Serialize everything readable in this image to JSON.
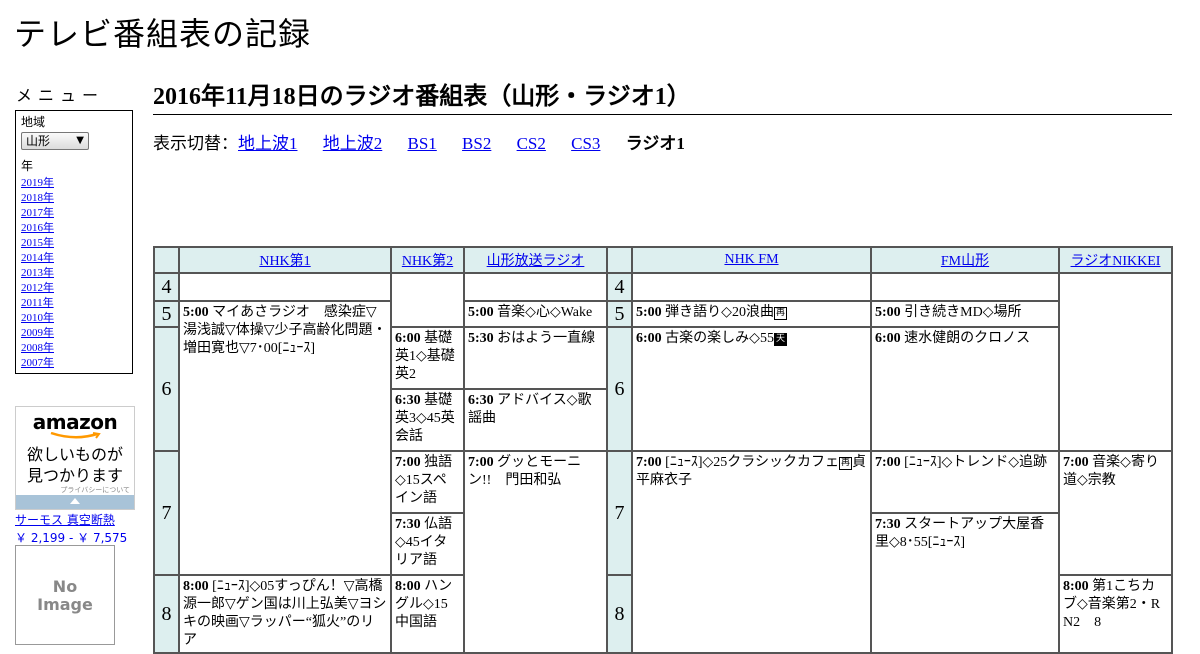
{
  "site_title": "テレビ番組表の記録",
  "menu": {
    "heading": "メニュー",
    "region_label": "地域",
    "region_value": "山形",
    "year_label": "年",
    "years": [
      "2019年",
      "2018年",
      "2017年",
      "2016年",
      "2015年",
      "2014年",
      "2013年",
      "2012年",
      "2011年",
      "2010年",
      "2009年",
      "2008年",
      "2007年"
    ]
  },
  "ads": {
    "amazon_logo": "amazon",
    "amazon_copy_1": "欲しいものが",
    "amazon_copy_2": "見つかります",
    "amazon_privacy": "プライバシーについて",
    "product_name": "サーモス 真空断熱",
    "product_price": "￥ 2,199 - ￥ 7,575",
    "noimage_1": "No",
    "noimage_2": "Image"
  },
  "page_title": "2016年11月18日のラジオ番組表（山形・ラジオ1）",
  "display_switch": {
    "label": "表示切替：",
    "options": [
      "地上波1",
      "地上波2",
      "BS1",
      "BS2",
      "CS2",
      "CS3"
    ],
    "current": "ラジオ1"
  },
  "schedule": {
    "channels": [
      "NHK第1",
      "NHK第2",
      "山形放送ラジオ",
      "NHK FM",
      "FM山形",
      "ラジオNIKKEI"
    ],
    "hours": [
      "4",
      "5",
      "6",
      "7",
      "8"
    ],
    "programs": {
      "nhk1_500_time": "5:00",
      "nhk1_500_title": "マイあさラジオ　感染症▽湯浅誠▽体操▽少子高齢化問題・増田寛也▽7･00[ﾆｭｰｽ]",
      "nhk1_800_time": "8:00",
      "nhk1_800_title": "[ﾆｭｰｽ]◇05すっぴん！▽高橋源一郎▽ゲン国は川上弘美▽ヨシキの映画▽ラッパー“狐火”のリア",
      "nhk2_600_time": "6:00",
      "nhk2_600_title": "基礎英1◇基礎英2",
      "nhk2_630_time": "6:30",
      "nhk2_630_title": "基礎英3◇45英会話",
      "nhk2_700_time": "7:00",
      "nhk2_700_title": "独語◇15スペイン語",
      "nhk2_730_time": "7:30",
      "nhk2_730_title": "仏語◇45イタリア語",
      "nhk2_800_time": "8:00",
      "nhk2_800_title": "ハングル◇15中国語",
      "ybc_500_time": "5:00",
      "ybc_500_title": "音楽◇心◇Wake",
      "ybc_530_time": "5:30",
      "ybc_530_title": "おはよう一直線",
      "ybc_630_time": "6:30",
      "ybc_630_title": "アドバイス◇歌謡曲",
      "ybc_700_time": "7:00",
      "ybc_700_title": "グッとモーニン!!　門田和弘",
      "fm_500_time": "5:00",
      "fm_500_title": "弾き語り◇20浪曲",
      "fm_600_time": "6:00",
      "fm_600_title": "古楽の楽しみ◇55",
      "fm_700_time": "7:00",
      "fm_700_title_a": "[ﾆｭｰｽ]◇25クラシックカフェ",
      "fm_700_title_b": "貞平麻衣子",
      "fmy_500_time": "5:00",
      "fmy_500_title": "引き続きMD◇場所",
      "fmy_600_time": "6:00",
      "fmy_600_title": "速水健朗のクロノス",
      "fmy_700_time": "7:00",
      "fmy_700_title": "[ﾆｭｰｽ]◇トレンド◇追跡",
      "fmy_730_time": "7:30",
      "fmy_730_title": "スタートアップ大屋香里◇8･55[ﾆｭｰｽ]",
      "nikkei_700_time": "7:00",
      "nikkei_700_title": "音楽◇寄り道◇宗教",
      "nikkei_800_time": "8:00",
      "nikkei_800_title": "第1こちカブ◇音楽第2・RN2　8"
    },
    "icons": {
      "fm_500_icon": "再",
      "fm_600_icon": "天",
      "fm_700_icon": "再"
    }
  }
}
